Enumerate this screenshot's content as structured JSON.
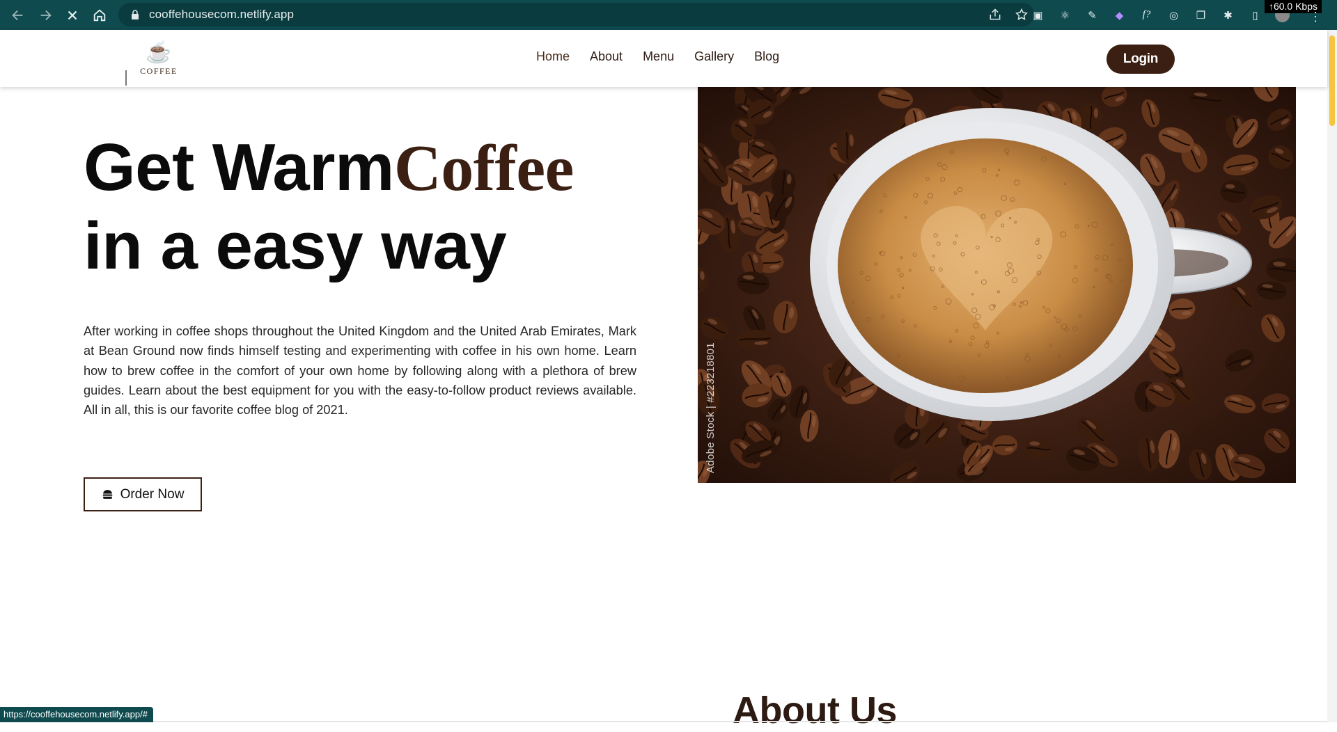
{
  "browser": {
    "url": "cooffehousecom.netlify.app",
    "speed": "↑60.0 Kbps",
    "status_url": "https://cooffehousecom.netlify.app/#"
  },
  "site": {
    "logo_text": "COFFEE",
    "nav": [
      "Home",
      "About",
      "Menu",
      "Gallery",
      "Blog"
    ],
    "login": "Login"
  },
  "hero": {
    "title_part1": "Get Warm",
    "title_accent": "Coffee",
    "title_line2": "in a easy way",
    "description": "After working in coffee shops throughout the United Kingdom and the United Arab Emirates, Mark at Bean Ground now finds himself testing and experimenting with coffee in his own home. Learn how to brew coffee in the comfort of your own home by following along with a plethora of brew guides. Learn about the best equipment for you with the easy-to-follow product reviews available. All in all, this is our favorite coffee blog of 2021.",
    "order_button": "Order Now",
    "image_watermark": "Adobe Stock | #223218801"
  },
  "about": {
    "title": "About Us"
  },
  "colors": {
    "brand_dark": "#3a1f12",
    "chrome": "#0f4a4f"
  }
}
